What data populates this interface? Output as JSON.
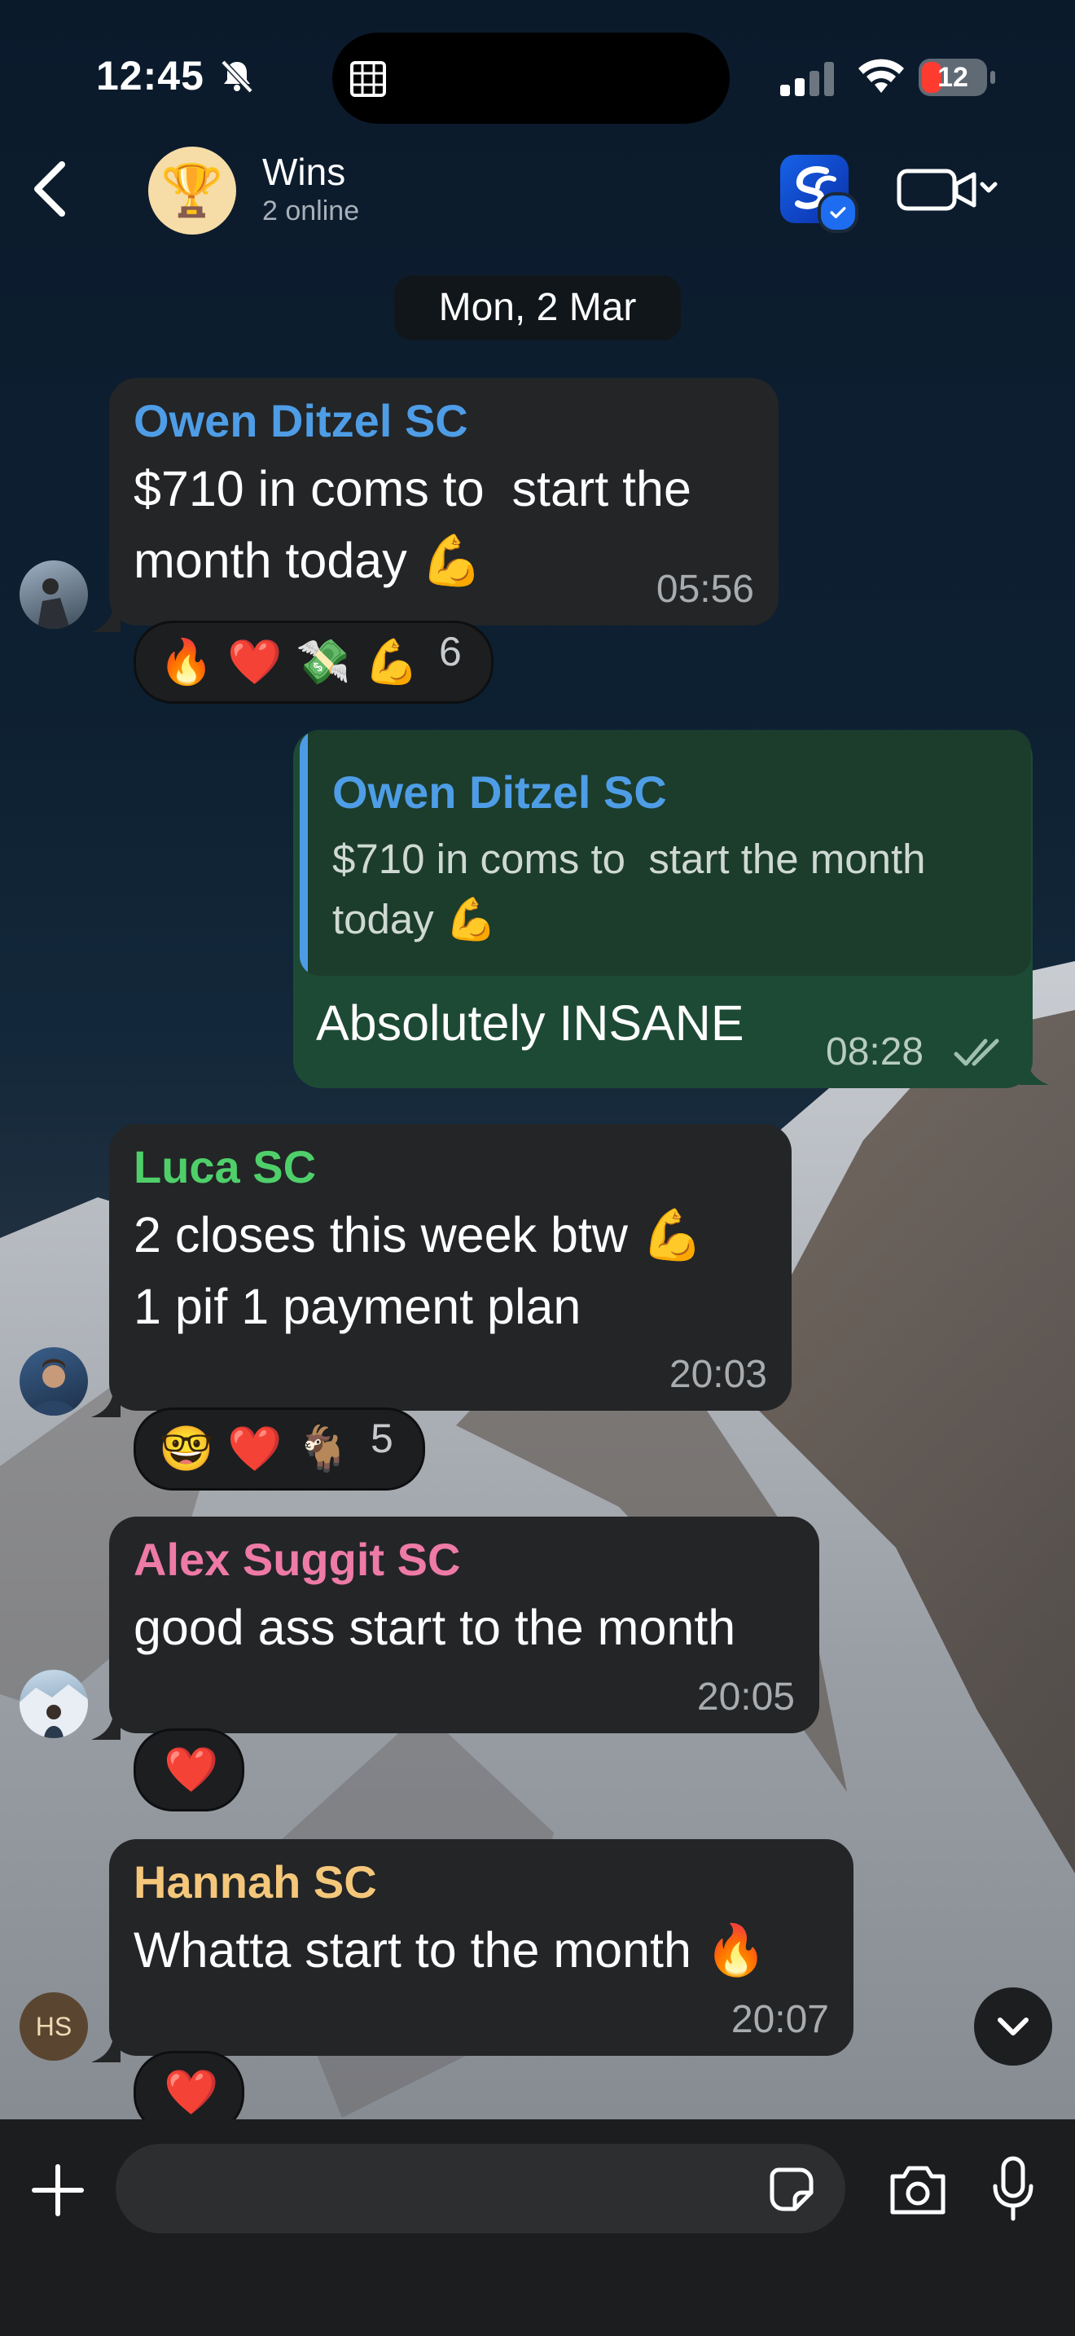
{
  "status_bar": {
    "time": "12:45",
    "battery": "12"
  },
  "header": {
    "title": "Wins",
    "subtitle": "2 online",
    "group_icon": "🏆"
  },
  "date_chip": "Mon, 2 Mar",
  "messages": [
    {
      "sender": "Owen Ditzel SC",
      "sender_color": "#4e9de6",
      "line1": "$710 in coms to  start the",
      "line2": "month today 💪",
      "time": "05:56",
      "reactions": [
        "🔥",
        "❤️",
        "💸",
        "💪"
      ],
      "reaction_count": "6"
    },
    {
      "outgoing": true,
      "quote_name": "Owen Ditzel SC",
      "quote_line1": "$710 in coms to  start the month",
      "quote_line2": "today 💪",
      "text": "Absolutely INSANE",
      "time": "08:28"
    },
    {
      "sender": "Luca SC",
      "sender_color": "#4fcf6a",
      "line1": "2 closes this week btw 💪",
      "line2": "1 pif 1 payment plan",
      "time": "20:03",
      "reactions": [
        "🤓",
        "❤️",
        "🐐"
      ],
      "reaction_count": "5"
    },
    {
      "sender": "Alex Suggit SC",
      "sender_color": "#ee7aa6",
      "line1": "good ass start to the month",
      "time": "20:05",
      "reactions": [
        "❤️"
      ]
    },
    {
      "sender": "Hannah SC",
      "sender_color": "#f4c77a",
      "line1": "Whatta start to the month 🔥",
      "time": "20:07",
      "avatar_initials": "HS",
      "reactions": [
        "❤️"
      ]
    }
  ],
  "colors": {
    "outgoing_bubble": "#1d4a35",
    "incoming_bubble": "#232527",
    "read_ticks": "#9fc0ad"
  }
}
